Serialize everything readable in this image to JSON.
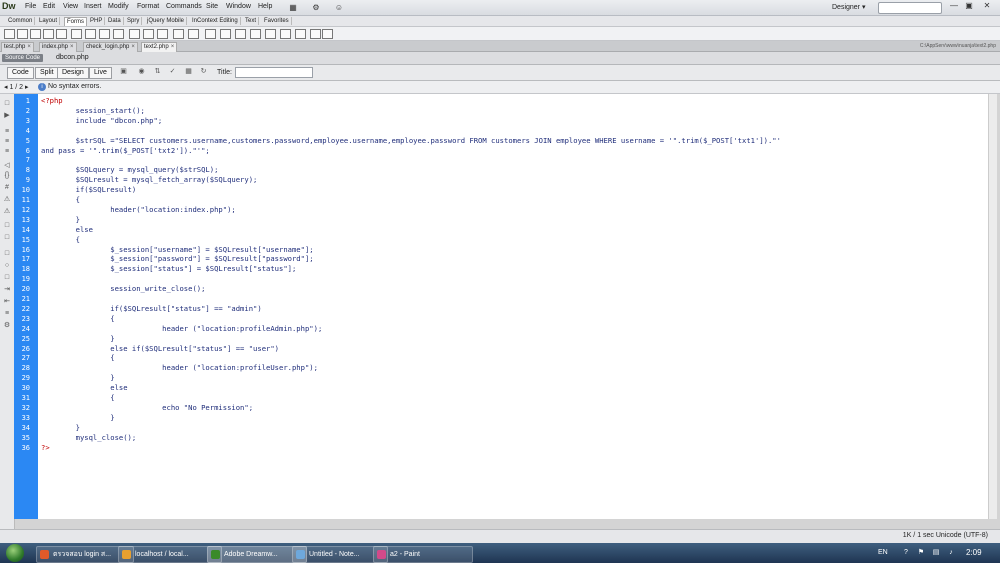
{
  "app": {
    "logo": "Dw"
  },
  "menu": [
    "File",
    "Edit",
    "View",
    "Insert",
    "Modify",
    "Format",
    "Commands",
    "Site",
    "Window",
    "Help"
  ],
  "toolbar_icons": [
    "layout-icon",
    "gear-icon",
    "user-icon"
  ],
  "workspace": {
    "label": "Designer ▾"
  },
  "window_controls": {
    "minimize": "—",
    "restore": "▣",
    "close": "✕"
  },
  "insert_tabs": [
    "Common",
    "Layout",
    "Forms",
    "PHP",
    "Data",
    "Spry",
    "jQuery Mobile",
    "InContext Editing",
    "Text",
    "Favorites"
  ],
  "active_insert_tab": "Forms",
  "doc_tabs": [
    {
      "label": "test.php"
    },
    {
      "label": "index.php"
    },
    {
      "label": "check_login.php"
    },
    {
      "label": "text2.php"
    }
  ],
  "doc_path": "C:\\AppServ\\www\\nuanja\\text2.php",
  "related": {
    "source_code": "Source Code",
    "file": "dbcon.php"
  },
  "view_buttons": {
    "code": "Code",
    "split": "Split",
    "design": "Design",
    "live": "Live"
  },
  "title_label": "Title:",
  "syntax": {
    "pager": "◂ 1 / 2 ▸",
    "message": "No syntax errors."
  },
  "code_lines": [
    "<?php",
    "        session_start();",
    "        include \"dbcon.php\";",
    "",
    "        $strSQL =\"SELECT customers.username,customers.password,employee.username,employee.password FROM customers JOIN employee WHERE username = '\".trim($_POST['txt1']).\"'",
    "and pass = '\".trim($_POST['txt2']).\"'\";",
    "",
    "        $SQLquery = mysql_query($strSQL);",
    "        $SQLresult = mysql_fetch_array($SQLquery);",
    "        if($SQLresult)",
    "        {",
    "                header(\"location:index.php\");",
    "        }",
    "        else",
    "        {",
    "                $_session[\"username\"] = $SQLresult[\"username\"];",
    "                $_session[\"password\"] = $SQLresult[\"password\"];",
    "                $_session[\"status\"] = $SQLresult[\"status\"];",
    "",
    "                session_write_close();",
    "",
    "                if($SQLresult[\"status\"] == \"admin\")",
    "                {",
    "                            header (\"location:profileAdmin.php\");",
    "                }",
    "                else if($SQLresult[\"status\"] == \"user\")",
    "                {",
    "                            header (\"location:profileUser.php\");",
    "                }",
    "                else",
    "                {",
    "                            echo \"No Permission\";",
    "                }",
    "        }",
    "        mysql_close();",
    "?>"
  ],
  "status": {
    "text": "1K / 1 sec  Unicode (UTF-8)"
  },
  "taskbar": {
    "tasks": [
      {
        "label": "ตรวจสอบ login ส...",
        "color": "#e05a2a"
      },
      {
        "label": "localhost / local...",
        "color": "#e8a030"
      },
      {
        "label": "Adobe Dreamw...",
        "color": "#3a8a2a"
      },
      {
        "label": "Untitled - Note...",
        "color": "#6ea8dc"
      },
      {
        "label": "a2 - Paint",
        "color": "#d24a8a"
      }
    ],
    "language": "EN",
    "clock": "2:09"
  }
}
